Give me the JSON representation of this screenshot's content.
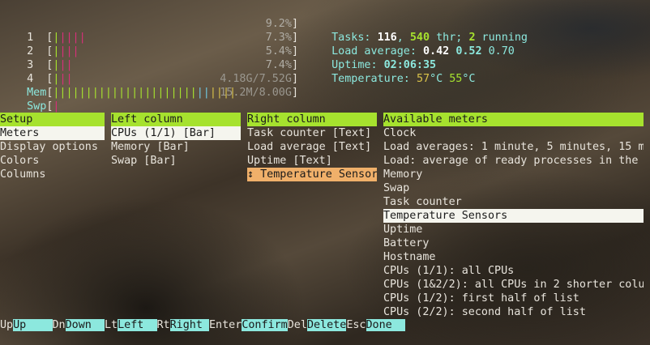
{
  "meters": {
    "cpus": [
      {
        "num": "1",
        "bars": [
          [
            "g",
            "|"
          ],
          [
            "r",
            "||||"
          ]
        ],
        "pct": "9.2%"
      },
      {
        "num": "2",
        "bars": [
          [
            "g",
            "|"
          ],
          [
            "r",
            "|||"
          ]
        ],
        "pct": "7.3%"
      },
      {
        "num": "3",
        "bars": [
          [
            "g",
            "|"
          ],
          [
            "r",
            "||"
          ]
        ],
        "pct": "5.4%"
      },
      {
        "num": "4",
        "bars": [
          [
            "g",
            "|"
          ],
          [
            "r",
            "||"
          ]
        ],
        "pct": "7.4%"
      }
    ],
    "mem": {
      "label": "Mem",
      "bar_green": "||||||||||||||||||||||",
      "bar_blue": "||",
      "bar_yellow": "||||",
      "value": "4.18G/7.52G"
    },
    "swp": {
      "label": "Swp",
      "bar_red": "|",
      "value": "15.2M/8.00G"
    },
    "tasks": {
      "label": "Tasks: ",
      "count": "116",
      "sep": ", ",
      "threads": "540",
      "thr": " thr; ",
      "running": "2",
      "running_label": " running"
    },
    "load": {
      "label": "Load average: ",
      "l1": "0.42",
      "l5": "0.52",
      "l15": "0.70"
    },
    "uptime": {
      "label": "Uptime: ",
      "value": "02:06:35"
    },
    "temperature": {
      "label": "Temperature: ",
      "t1": "57",
      "unit1": "°C ",
      "t2": "55",
      "unit2": "°C"
    }
  },
  "setup": {
    "header": "Setup",
    "items": [
      "Meters",
      "Display options",
      "Colors",
      "Columns"
    ]
  },
  "left_column": {
    "header": "Left column",
    "items": [
      "CPUs (1/1) [Bar]",
      "Memory [Bar]",
      "Swap [Bar]"
    ]
  },
  "right_column": {
    "header": "Right column",
    "items": [
      "Task counter [Text]",
      "Load average [Text]",
      "Uptime [Text]",
      "↕ Temperature Sensor"
    ]
  },
  "available": {
    "header": "Available meters",
    "items": [
      "Clock",
      "Load averages: 1 minute, 5 minutes, 15 m",
      "Load: average of ready processes in the",
      "Memory",
      "Swap",
      "Task counter",
      "Temperature Sensors",
      "Uptime",
      "Battery",
      "Hostname",
      "CPUs (1/1): all CPUs",
      "CPUs (1&2/2): all CPUs in 2 shorter colu",
      "CPUs (1/2): first half of list",
      "CPUs (2/2): second half of list"
    ]
  },
  "footer": [
    {
      "key": "Up",
      "label": "Up    "
    },
    {
      "key": "Dn",
      "label": "Down  "
    },
    {
      "key": "Lt",
      "label": "Left  "
    },
    {
      "key": "Rt",
      "label": "Right "
    },
    {
      "key": "Enter",
      "label": "Confirm"
    },
    {
      "key": "Del",
      "label": "Delete"
    },
    {
      "key": "Esc",
      "label": "Done  "
    }
  ],
  "colors": {
    "header_green": "#a6e22e",
    "footer_cyan": "#8ce8de",
    "selected_orange": "#f0b06a"
  }
}
